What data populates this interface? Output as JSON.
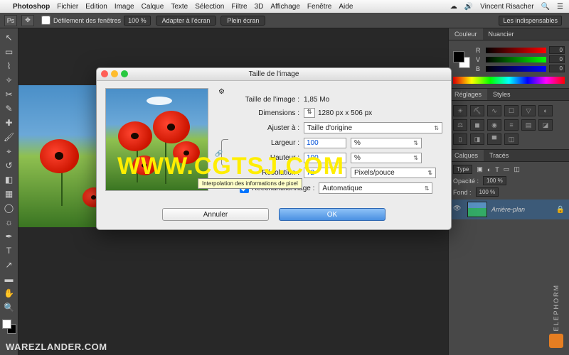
{
  "menubar": {
    "app": "Photoshop",
    "items": [
      "Fichier",
      "Edition",
      "Image",
      "Calque",
      "Texte",
      "Sélection",
      "Filtre",
      "3D",
      "Affichage",
      "Fenêtre",
      "Aide"
    ],
    "user": "Vincent Risacher"
  },
  "optbar": {
    "scroll_label": "Défilement des fenêtres",
    "zoom": "100 %",
    "fit_screen": "Adapter à l'écran",
    "full_screen": "Plein écran",
    "workspace_drop": "Les indispensables"
  },
  "panels": {
    "color_tab": "Couleur",
    "swatch_tab": "Nuancier",
    "channels": {
      "r": "R",
      "v": "V",
      "b": "B",
      "rv": "0",
      "vv": "0",
      "bv": "0"
    },
    "adjust_tab": "Réglages",
    "styles_tab": "Styles",
    "layers_tab": "Calques",
    "paths_tab": "Tracés",
    "mode_drop": "Type",
    "opacity_lbl": "Opacité :",
    "opacity_val": "100 %",
    "fill_lbl": "Fond :",
    "fill_val": "100 %",
    "layer_name": "Arrière-plan"
  },
  "dialog": {
    "title": "Taille de l'image",
    "size_label": "Taille de l'image :",
    "size_value": "1,85 Mo",
    "dims_label": "Dimensions :",
    "dims_value": "1280 px x 506 px",
    "fit_label": "Ajuster à :",
    "fit_value": "Taille d'origine",
    "width_label": "Largeur :",
    "width_value": "100",
    "width_unit": "%",
    "height_label": "Hauteur :",
    "height_value": "100",
    "height_unit": "%",
    "res_label": "Résolution :",
    "res_value": "72",
    "res_unit": "Pixels/pouce",
    "resample_label": "Rééchantillonnage :",
    "resample_value": "Automatique",
    "tooltip": "Interpolation des informations de pixel",
    "cancel": "Annuler",
    "ok": "OK"
  },
  "watermarks": {
    "center": "WWW.CGTSJ.COM",
    "bottom": "WAREZLANDER.COM",
    "brand": "ELEPHORM"
  }
}
